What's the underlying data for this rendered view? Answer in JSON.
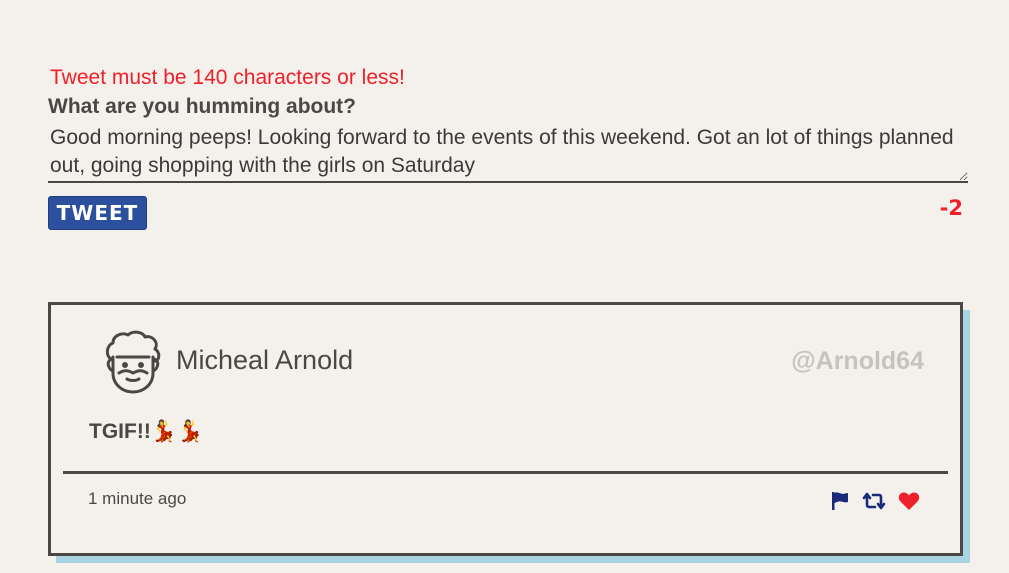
{
  "compose": {
    "error_message": "Tweet must be 140 characters or less!",
    "label": "What are you humming about?",
    "text_value": "Good morning peeps! Looking forward to the events of this weekend. Got an lot of things planned out, going shopping with the girls on Saturday",
    "tweet_button_label": "TWEET",
    "char_counter": "-2"
  },
  "tweet": {
    "user_name": "Micheal Arnold",
    "handle": "@Arnold64",
    "avatar_icon": "bearded-face-icon",
    "text": "TGIF!!💃💃",
    "timestamp": "1 minute ago",
    "actions": [
      {
        "icon": "flag-icon",
        "color": "#1a2a7a"
      },
      {
        "icon": "retweet-icon",
        "color": "#1a2a7a"
      },
      {
        "icon": "heart-icon",
        "color": "#f0202a"
      }
    ]
  },
  "colors": {
    "error": "#f0202a",
    "button": "#2c4f9e",
    "card_shadow": "#a8d4e2",
    "handle": "#c6c3bd",
    "background": "#f4f1ec"
  }
}
